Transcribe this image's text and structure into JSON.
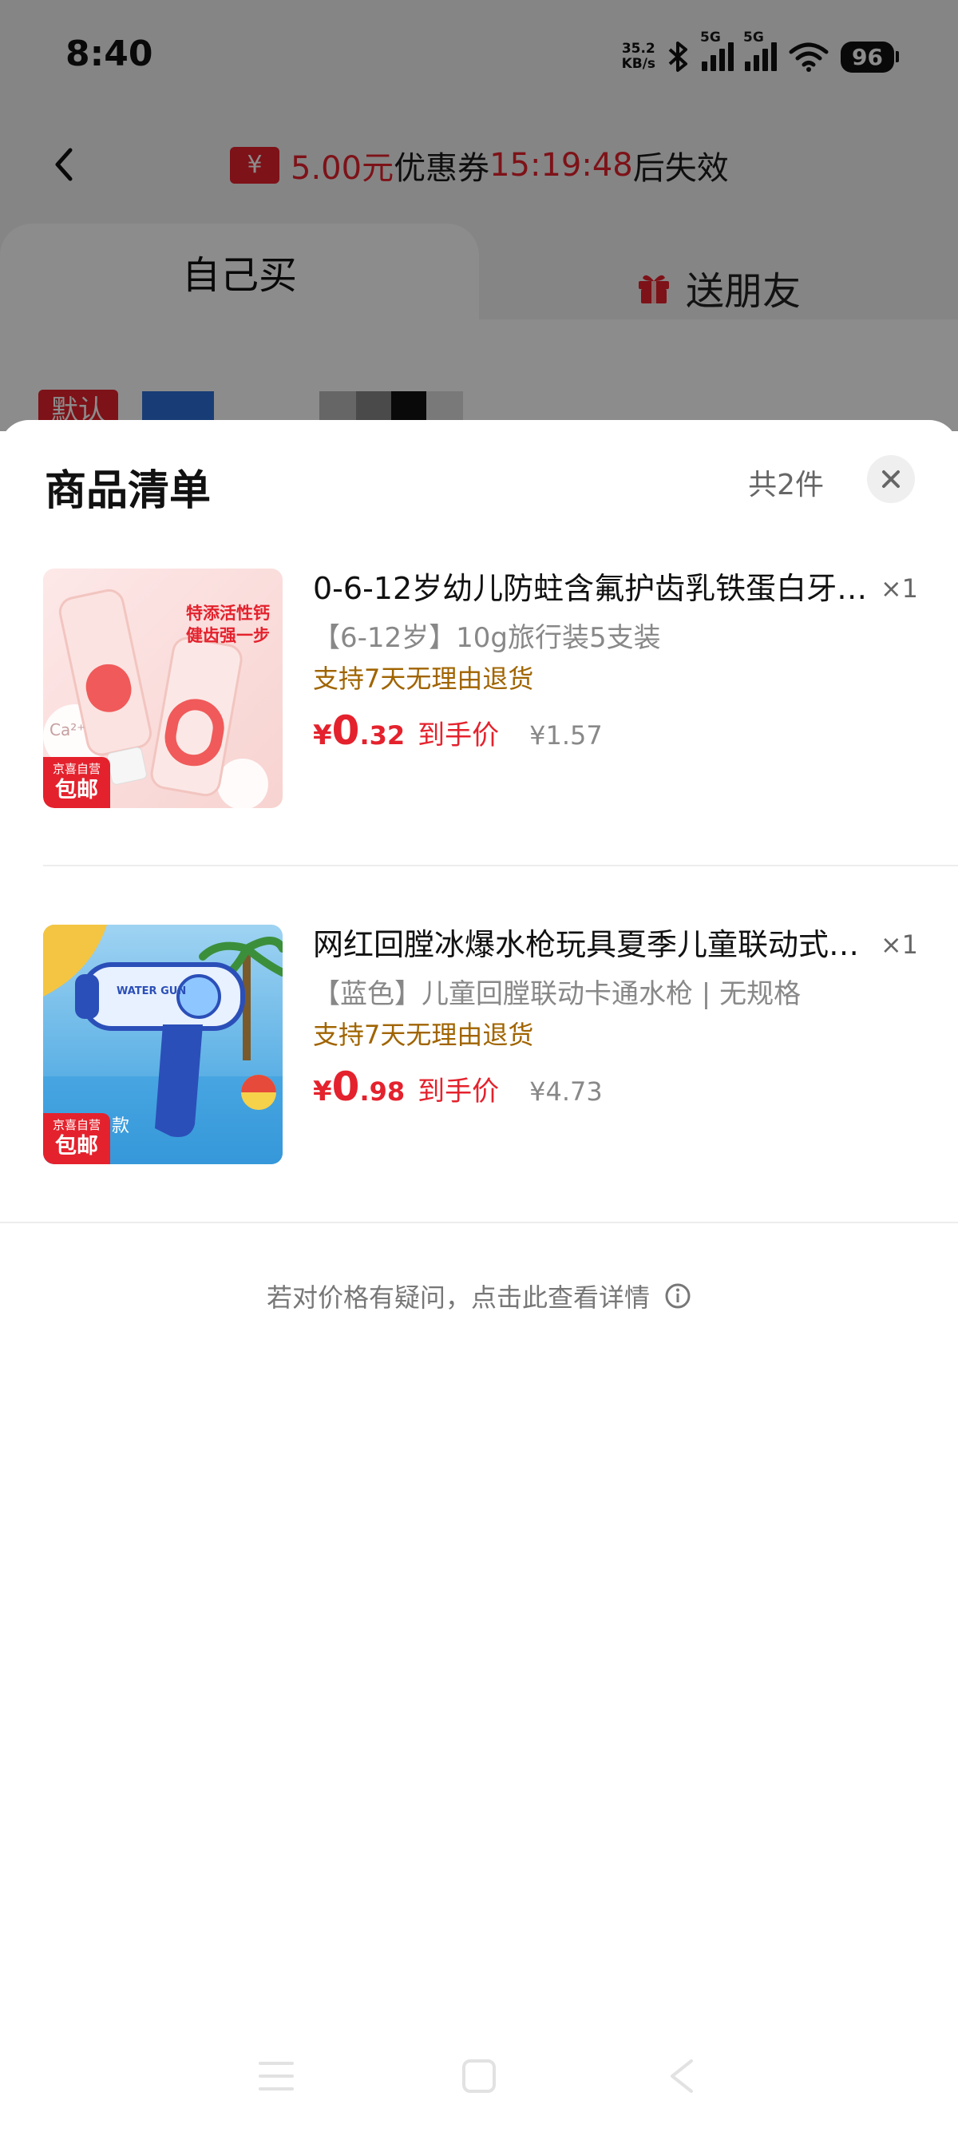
{
  "status_bar": {
    "time": "8:40",
    "net_speed_value": "35.2",
    "net_speed_unit": "KB/s",
    "signal1_label": "5G",
    "signal2_label": "5G",
    "battery": "96"
  },
  "header": {
    "coupon_amount": "5.00元",
    "coupon_text": "优惠券",
    "coupon_countdown": "15:19:48",
    "coupon_suffix": "后失效",
    "coupon_icon_glyph": "¥"
  },
  "tabs": [
    {
      "label": "自己买",
      "active": true
    },
    {
      "label": "送朋友",
      "active": false
    }
  ],
  "address": {
    "default_tag": "默认"
  },
  "sheet": {
    "title": "商品清单",
    "count": "共2件",
    "close_icon": "close-icon"
  },
  "items": [
    {
      "title": "0-6-12岁幼儿防蛀含氟护齿乳铁蛋白牙…",
      "quantity": "×1",
      "spec": "【6-12岁】10g旅行装5支装",
      "return_policy": "支持7天无理由退货",
      "price_currency": "¥",
      "price_int": "0",
      "price_dec": ".32",
      "price_label": "到手价",
      "original_price": "¥1.57",
      "badge_line1": "京喜自营",
      "badge_line2": "包邮",
      "thumb_texts": [
        "特添活性钙",
        "健齿强一步",
        "Ca²⁺"
      ]
    },
    {
      "title": "网红回膛冰爆水枪玩具夏季儿童联动式…",
      "quantity": "×1",
      "spec": "【蓝色】儿童回膛联动卡通水枪 | 无规格",
      "return_policy": "支持7天无理由退货",
      "price_currency": "¥",
      "price_int": "0",
      "price_dec": ".98",
      "price_label": "到手价",
      "original_price": "¥4.73",
      "badge_line1": "京喜自营",
      "badge_line2": "包邮",
      "thumb_texts": [
        "WATER GUN",
        "款"
      ]
    }
  ],
  "footer": {
    "price_question": "若对价格有疑问，点击此查看详情"
  },
  "colors": {
    "accent_red": "#e4222d",
    "return_brown": "#a06400"
  }
}
